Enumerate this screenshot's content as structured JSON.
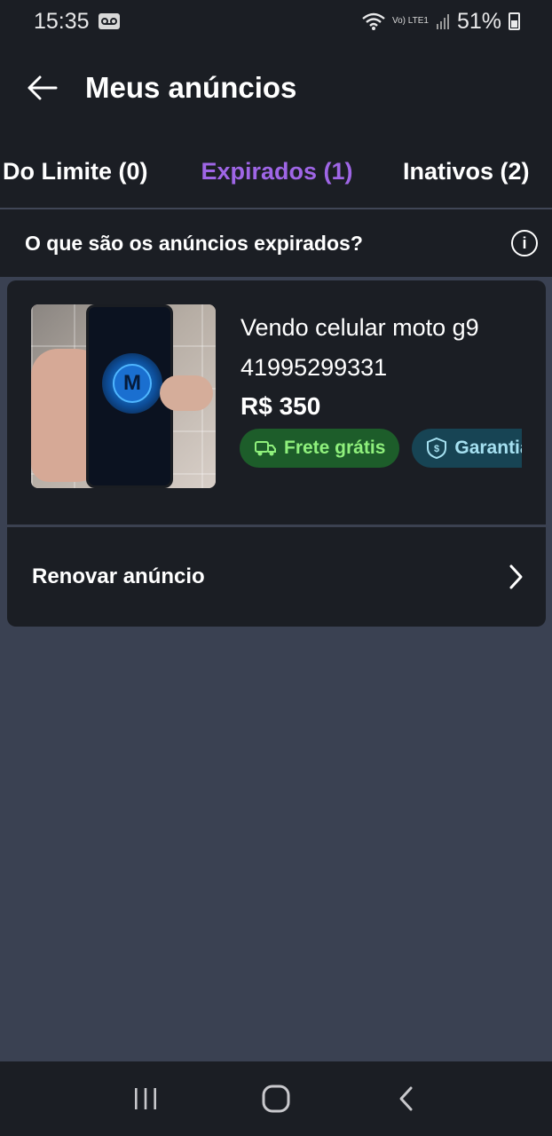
{
  "status_bar": {
    "time": "15:35",
    "network_label": "Vo) LTE1",
    "battery": "51%"
  },
  "header": {
    "title": "Meus anúncios"
  },
  "tabs": [
    {
      "label": "Do Limite (0)"
    },
    {
      "label": "Expirados (1)"
    },
    {
      "label": "Inativos (2)"
    }
  ],
  "info_bar": {
    "text": "O que são os anúncios expirados?",
    "icon": "info-icon"
  },
  "listing": {
    "title": "Vendo celular moto g9",
    "subtitle": "41995299331",
    "price": "R$ 350",
    "badges": [
      {
        "label": "Frete grátis",
        "icon": "truck-icon"
      },
      {
        "label": "Garantia",
        "icon": "shield-icon"
      }
    ]
  },
  "renew": {
    "label": "Renovar anúncio"
  },
  "colors": {
    "accent": "#9f66e6",
    "dark_bg": "#1b1e24",
    "page_bg": "#3a4152"
  }
}
